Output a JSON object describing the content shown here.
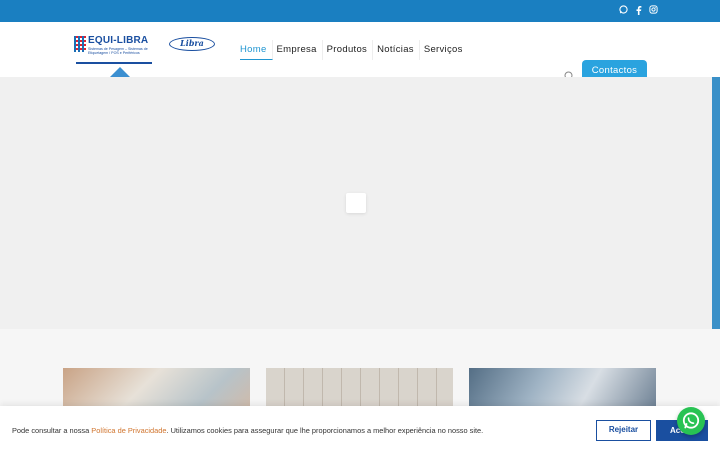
{
  "topbar": {
    "social": [
      "whatsapp-icon",
      "facebook-icon",
      "instagram-icon"
    ]
  },
  "brand": {
    "logo_name": "EQUI-LIBRA",
    "logo_tagline": "Sistemas de Pesagem – Sistemas de Etiquetagem / POS e Periféricos",
    "partner_logo": "Libra"
  },
  "nav": {
    "items": [
      {
        "label": "Home",
        "active": true
      },
      {
        "label": "Empresa",
        "active": false
      },
      {
        "label": "Produtos",
        "active": false
      },
      {
        "label": "Notícias",
        "active": false
      },
      {
        "label": "Serviços",
        "active": false
      }
    ]
  },
  "header": {
    "contact_label": "Contactos"
  },
  "cookie": {
    "text_before": "Pode consultar a nossa ",
    "link_label": "Política de Privacidade",
    "text_after": ". Utilizamos cookies para assegurar que lhe proporcionamos a melhor experiência no nosso site.",
    "reject_label": "Rejeitar",
    "accept_label": "Aceitar"
  },
  "colors": {
    "primary": "#1a7fc1",
    "accent": "#2aa3df",
    "dark_blue": "#1a4fa0",
    "link": "#d0742d",
    "whatsapp": "#28c353"
  }
}
